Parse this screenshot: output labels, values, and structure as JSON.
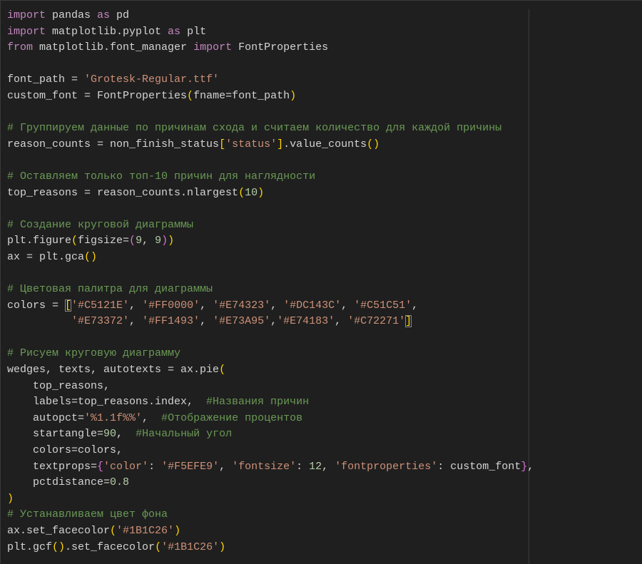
{
  "editor": {
    "lines": [
      [
        [
          "kw",
          "import"
        ],
        [
          "t",
          " pandas "
        ],
        [
          "kw",
          "as"
        ],
        [
          "t",
          " pd"
        ]
      ],
      [
        [
          "kw",
          "import"
        ],
        [
          "t",
          " matplotlib.pyplot "
        ],
        [
          "kw",
          "as"
        ],
        [
          "t",
          " plt"
        ]
      ],
      [
        [
          "kw",
          "from"
        ],
        [
          "t",
          " matplotlib.font_manager "
        ],
        [
          "kw",
          "import"
        ],
        [
          "t",
          " FontProperties"
        ]
      ],
      [],
      [
        [
          "t",
          "font_path = "
        ],
        [
          "str",
          "'Grotesk-Regular.ttf'"
        ]
      ],
      [
        [
          "t",
          "custom_font = FontProperties"
        ],
        [
          "b1",
          "("
        ],
        [
          "t",
          "fname=font_path"
        ],
        [
          "b1",
          ")"
        ]
      ],
      [],
      [
        [
          "com",
          "# Группируем данные по причинам схода и считаем количество для каждой причины"
        ]
      ],
      [
        [
          "t",
          "reason_counts = non_finish_status"
        ],
        [
          "b1",
          "["
        ],
        [
          "str",
          "'status'"
        ],
        [
          "b1",
          "]"
        ],
        [
          "t",
          ".value_counts"
        ],
        [
          "b1",
          "()"
        ]
      ],
      [],
      [
        [
          "com",
          "# Оставляем только топ-10 причин для наглядности"
        ]
      ],
      [
        [
          "t",
          "top_reasons = reason_counts.nlargest"
        ],
        [
          "b1",
          "("
        ],
        [
          "num",
          "10"
        ],
        [
          "b1",
          ")"
        ]
      ],
      [],
      [
        [
          "com",
          "# Создание круговой диаграммы"
        ]
      ],
      [
        [
          "t",
          "plt.figure"
        ],
        [
          "b1",
          "("
        ],
        [
          "t",
          "figsize="
        ],
        [
          "b2",
          "("
        ],
        [
          "num",
          "9"
        ],
        [
          "t",
          ", "
        ],
        [
          "num",
          "9"
        ],
        [
          "b2",
          ")"
        ],
        [
          "b1",
          ")"
        ]
      ],
      [
        [
          "t",
          "ax = plt.gca"
        ],
        [
          "b1",
          "()"
        ]
      ],
      [],
      [
        [
          "com",
          "# Цветовая палитра для диаграммы"
        ]
      ],
      [
        [
          "t",
          "colors = "
        ],
        [
          "b1 bm",
          "["
        ],
        [
          "str",
          "'#C5121E'"
        ],
        [
          "t",
          ", "
        ],
        [
          "str",
          "'#FF0000'"
        ],
        [
          "t",
          ", "
        ],
        [
          "str",
          "'#E74323'"
        ],
        [
          "t",
          ", "
        ],
        [
          "str",
          "'#DC143C'"
        ],
        [
          "t",
          ", "
        ],
        [
          "str",
          "'#C51C51'"
        ],
        [
          "t",
          ","
        ]
      ],
      [
        [
          "t",
          "          "
        ],
        [
          "str",
          "'#E73372'"
        ],
        [
          "t",
          ", "
        ],
        [
          "str",
          "'#FF1493'"
        ],
        [
          "t",
          ", "
        ],
        [
          "str",
          "'#E73A95'"
        ],
        [
          "t",
          ","
        ],
        [
          "str",
          "'#E74183'"
        ],
        [
          "t",
          ", "
        ],
        [
          "str",
          "'#C72271'"
        ],
        [
          "b1 bm",
          "]"
        ]
      ],
      [],
      [
        [
          "com",
          "# Рисуем круговую диаграмму"
        ]
      ],
      [
        [
          "t",
          "wedges, texts, autotexts = ax.pie"
        ],
        [
          "b1",
          "("
        ]
      ],
      [
        [
          "t",
          "    top_reasons,"
        ]
      ],
      [
        [
          "t",
          "    labels=top_reasons.index,  "
        ],
        [
          "com",
          "#Названия причин"
        ]
      ],
      [
        [
          "t",
          "    autopct="
        ],
        [
          "str",
          "'%1.1f%%'"
        ],
        [
          "t",
          ",  "
        ],
        [
          "com",
          "#Отображение процентов"
        ]
      ],
      [
        [
          "t",
          "    startangle="
        ],
        [
          "num",
          "90"
        ],
        [
          "t",
          ",  "
        ],
        [
          "com",
          "#Начальный угол"
        ]
      ],
      [
        [
          "t",
          "    colors=colors,"
        ]
      ],
      [
        [
          "t",
          "    textprops="
        ],
        [
          "b2",
          "{"
        ],
        [
          "str",
          "'color'"
        ],
        [
          "t",
          ": "
        ],
        [
          "str",
          "'#F5EFE9'"
        ],
        [
          "t",
          ", "
        ],
        [
          "str",
          "'fontsize'"
        ],
        [
          "t",
          ": "
        ],
        [
          "num",
          "12"
        ],
        [
          "t",
          ", "
        ],
        [
          "str",
          "'fontproperties'"
        ],
        [
          "t",
          ": custom_font"
        ],
        [
          "b2",
          "}"
        ],
        [
          "t",
          ","
        ]
      ],
      [
        [
          "t",
          "    pctdistance="
        ],
        [
          "num",
          "0.8"
        ]
      ],
      [
        [
          "b1",
          ")"
        ]
      ],
      [
        [
          "com",
          "# Устанавливаем цвет фона"
        ]
      ],
      [
        [
          "t",
          "ax.set_facecolor"
        ],
        [
          "b1",
          "("
        ],
        [
          "str",
          "'#1B1C26'"
        ],
        [
          "b1",
          ")"
        ]
      ],
      [
        [
          "t",
          "plt.gcf"
        ],
        [
          "b1",
          "()"
        ],
        [
          "t",
          ".set_facecolor"
        ],
        [
          "b1",
          "("
        ],
        [
          "str",
          "'#1B1C26'"
        ],
        [
          "b1",
          ")"
        ]
      ]
    ]
  },
  "colors": {
    "background": "#1f1f1f",
    "keyword": "#c586c0",
    "string": "#ce9178",
    "comment": "#6a9955",
    "number": "#b5cea8",
    "text": "#d4d4d4"
  }
}
